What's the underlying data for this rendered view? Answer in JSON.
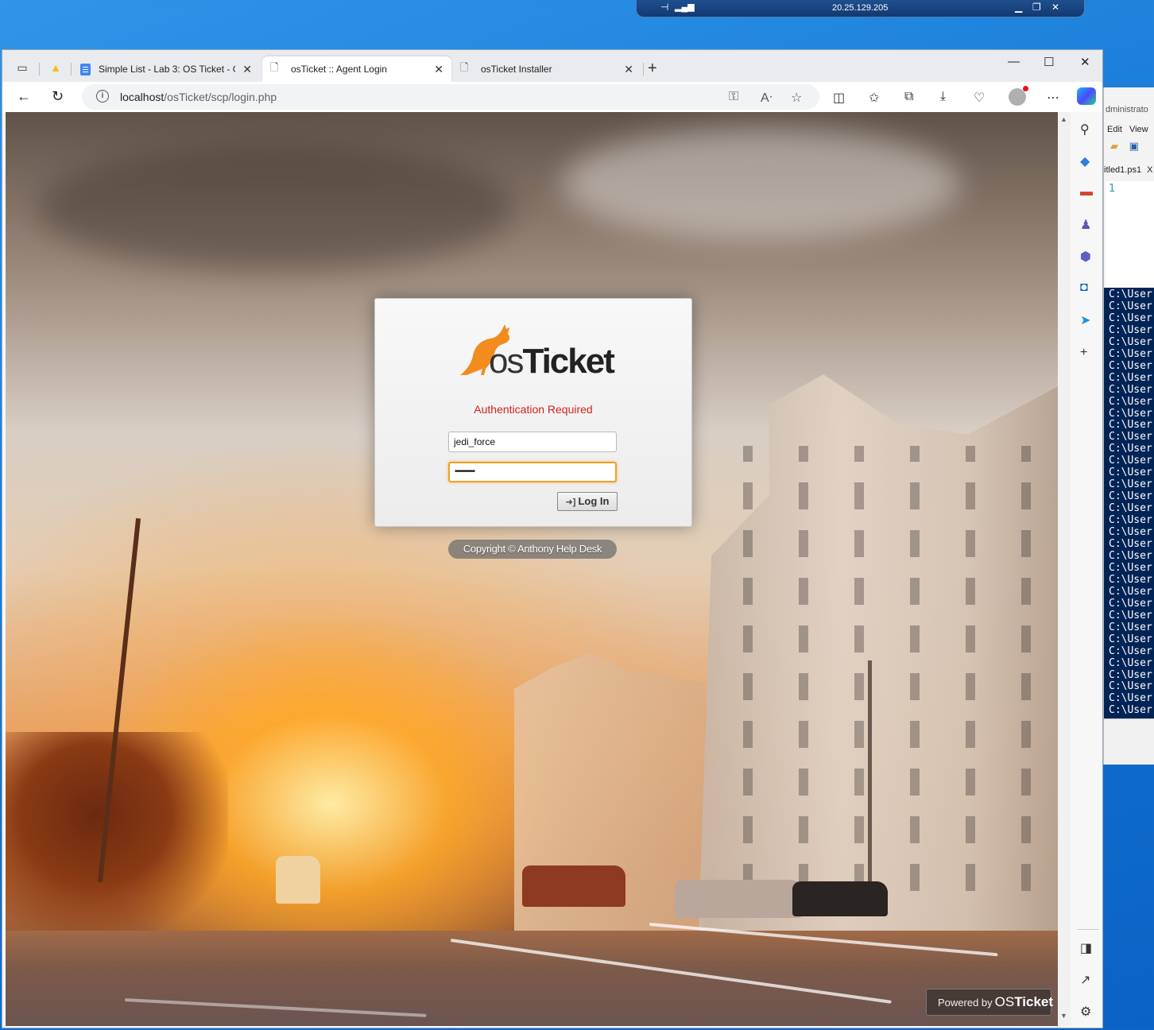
{
  "rdp": {
    "ip": "20.25.129.205"
  },
  "powershell": {
    "title": "dministrato",
    "menu": [
      "Edit",
      "View"
    ],
    "tab": "itled1.ps1",
    "tab_close": "X",
    "line_number": "1",
    "console_lines": [
      "C:\\User",
      "C:\\User",
      "C:\\User",
      "C:\\User",
      "C:\\User",
      "C:\\User",
      "C:\\User",
      "C:\\User",
      "C:\\User",
      "C:\\User",
      "C:\\User",
      "C:\\User",
      "C:\\User",
      "C:\\User",
      "C:\\User",
      "C:\\User",
      "C:\\User",
      "C:\\User",
      "C:\\User",
      "C:\\User",
      "C:\\User",
      "C:\\User",
      "C:\\User",
      "C:\\User",
      "C:\\User",
      "C:\\User",
      "C:\\User",
      "C:\\User",
      "C:\\User",
      "C:\\User",
      "C:\\User",
      "C:\\User",
      "C:\\User",
      "C:\\User",
      "C:\\User",
      "C:\\User"
    ]
  },
  "browser": {
    "tabs": [
      {
        "label": "Simple List - Lab 3: OS Ticket - G",
        "icon": "google-docs-icon"
      },
      {
        "label": "osTicket :: Agent Login",
        "icon": "page-icon",
        "active": true
      },
      {
        "label": "osTicket Installer",
        "icon": "page-icon"
      }
    ],
    "url_host": "localhost",
    "url_path": "/osTicket/scp/login.php"
  },
  "login": {
    "logo_os": "os",
    "logo_ticket": "Ticket",
    "auth_message": "Authentication Required",
    "username_value": "jedi_force",
    "password_value": "••••••••••",
    "login_button": "Log In",
    "copyright": "Copyright © Anthony Help Desk"
  },
  "footer": {
    "powered_by": "Powered by",
    "brand_os": "OS",
    "brand_ticket": "Ticket"
  },
  "colors": {
    "auth_message": "#d42020",
    "focus_border": "#f0a020",
    "console_bg": "#012456",
    "desktop_bg": "#1679d6"
  }
}
